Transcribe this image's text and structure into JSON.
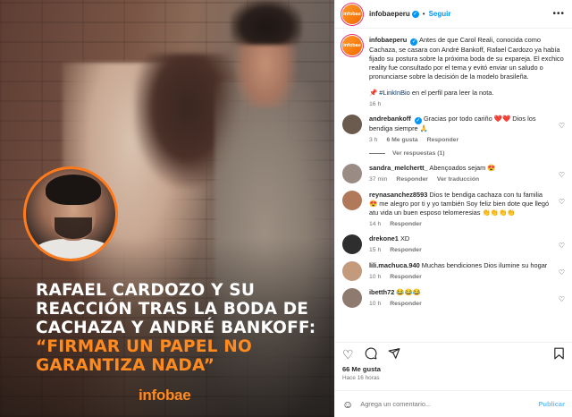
{
  "post_image": {
    "headline_white": "RAFAEL CARDOZO Y SU REACCIÓN TRAS LA BODA DE CACHAZA Y ANDRÉ BANKOFF:",
    "headline_orange": "“FIRMAR UN PAPEL NO GARANTIZA NADA”",
    "brand": "infobae"
  },
  "header": {
    "avatar_text": "infobae",
    "username": "infobaeperu",
    "follow_label": "Seguir",
    "more_label": "•••"
  },
  "caption": {
    "avatar_text": "infobae",
    "username": "infobaeperu",
    "text": "Antes de que Carol Reali, conocida como Cachaza, se casara con André Bankoff, Rafael Cardozo ya había fijado su postura sobre la próxima boda de su expareja. El exchico reality fue consultado por el tema y evitó enviar un saludo o pronunciarse sobre la decisión de la modelo brasileña.",
    "link_prefix": "📌 ",
    "hashtag": "#LinkInBio",
    "link_suffix": " en el perfil para leer la nota.",
    "time": "16 h"
  },
  "comments": [
    {
      "username": "andrebankoff",
      "verified": true,
      "text": "Gracias por todo cariño ❤️❤️ Dios los bendiga siempre 🙏",
      "time": "3 h",
      "likes": "6 Me gusta",
      "reply": "Responder",
      "avatar_color": "#6b5a4e"
    },
    {
      "username": "sandra_melchertt_",
      "verified": false,
      "text": "Abençoados sejam 😍",
      "time": "37 min",
      "likes": "",
      "reply": "Responder",
      "translate": "Ver traducción",
      "avatar_color": "#9a8c84"
    },
    {
      "username": "reynasanchez8593",
      "verified": false,
      "text": "Dios te bendiga cachaza con tu familia 😍 me alegro por ti y yo también Soy feliz bien dote que llegó atu vida un buen esposo telomeresias 👏👏👏👏",
      "time": "14 h",
      "likes": "",
      "reply": "Responder",
      "avatar_color": "#b07a5a"
    },
    {
      "username": "drekone1",
      "verified": false,
      "text": "XD",
      "time": "15 h",
      "likes": "",
      "reply": "Responder",
      "avatar_color": "#2e2e2e"
    },
    {
      "username": "lili.machuca.940",
      "verified": false,
      "text": "Muchas bendiciones Dios ilumine su hogar",
      "time": "10 h",
      "likes": "",
      "reply": "Responder",
      "avatar_color": "#c49a7c"
    },
    {
      "username": "ibetth72",
      "verified": false,
      "text": "😂😂😂",
      "time": "10 h",
      "likes": "",
      "reply": "Responder",
      "avatar_color": "#8f7a70"
    }
  ],
  "view_replies_label": "Ver respuestas (1)",
  "actions": {
    "likes": "66 Me gusta",
    "posted": "Hace 16 horas"
  },
  "add_comment": {
    "placeholder": "Agrega un comentario...",
    "publish_label": "Publicar"
  }
}
